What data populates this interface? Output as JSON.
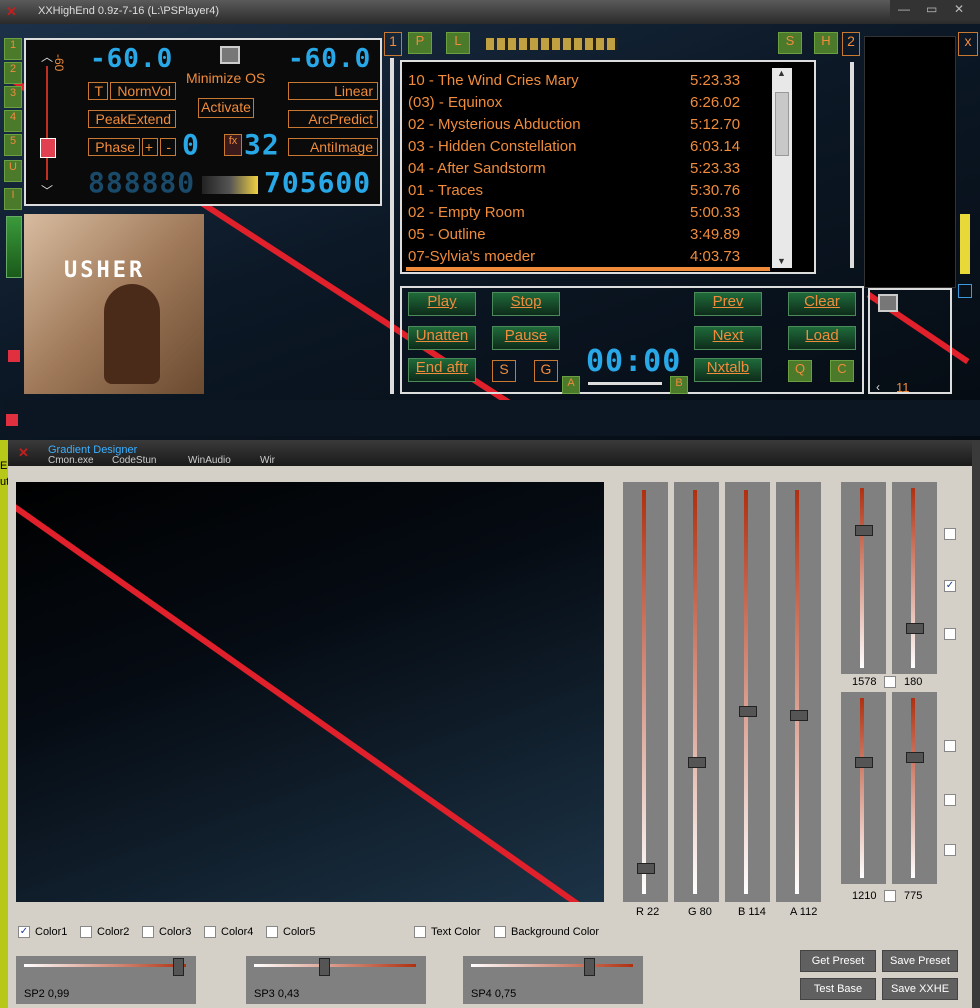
{
  "main_window": {
    "title": "XXHighEnd 0.9z-7-16 (L:\\PSPlayer4)",
    "left_tabs": [
      "1",
      "2",
      "3",
      "4",
      "5",
      "U",
      "I"
    ],
    "volume_readout_left": "-60.0",
    "volume_readout_right": "-60.0",
    "vol_scale_label": "-60",
    "minimize_os": "Minimize OS",
    "activate": "Activate",
    "buttons": {
      "t": "T",
      "normvol": "NormVol",
      "peakextend": "PeakExtend",
      "phase": "Phase",
      "plus": "+",
      "minus": "-",
      "linear": "Linear",
      "arcpredict": "ArcPredict",
      "antiimage": "AntiImage"
    },
    "fx_label": "fx",
    "fx_left": "0",
    "fx_right": "32",
    "counter_left": "888880",
    "counter_right": "705600",
    "panel_1": "1",
    "panel_2": "2",
    "close_x": "x",
    "p_btn": "P",
    "l_btn": "L",
    "s_btn": "S",
    "h_btn": "H",
    "album_text": "USHER"
  },
  "playlist": [
    {
      "title": "10 - The Wind Cries Mary",
      "duration": "5:23.33"
    },
    {
      "title": "(03) - Equinox",
      "duration": "6:26.02"
    },
    {
      "title": "02 - Mysterious Abduction",
      "duration": "5:12.70"
    },
    {
      "title": "03 - Hidden Constellation",
      "duration": "6:03.14"
    },
    {
      "title": "04 - After Sandstorm",
      "duration": "5:23.33"
    },
    {
      "title": "01 - Traces",
      "duration": "5:30.76"
    },
    {
      "title": "02 - Empty Room",
      "duration": "5:00.33"
    },
    {
      "title": "05 - Outline",
      "duration": "3:49.89"
    },
    {
      "title": "07-Sylvia's moeder",
      "duration": "4:03.73"
    }
  ],
  "transport": {
    "play": "Play",
    "stop": "Stop",
    "prev": "Prev",
    "clear": "Clear",
    "unatten": "Unatten",
    "pause": "Pause",
    "next": "Next",
    "load": "Load",
    "end_aftr": "End aftr",
    "s": "S",
    "g": "G",
    "nxtalb": "Nxtalb",
    "q": "Q",
    "c": "C",
    "a": "A",
    "b": "B",
    "time": "00:00"
  },
  "mini": {
    "value": "11"
  },
  "gradient_designer": {
    "title": "Gradient Designer",
    "behind_text": [
      "EX",
      "ut",
      "Cmon.exe",
      "CodeStun",
      "WinAudio",
      "Wir"
    ],
    "channels": [
      {
        "label": "R 22",
        "level": 0.05
      },
      {
        "label": "G 80",
        "level": 0.32
      },
      {
        "label": "B 114",
        "level": 0.45
      },
      {
        "label": "A 112",
        "level": 0.44
      }
    ],
    "pair1": {
      "left": "1578",
      "right": "180",
      "left_level": 0.78,
      "right_level": 0.2
    },
    "pair2": {
      "left": "1210",
      "right": "775",
      "left_level": 0.65,
      "right_level": 0.68
    },
    "side_checks": [
      false,
      true,
      false,
      false,
      false,
      false
    ],
    "color_checks": [
      {
        "label": "Color1",
        "checked": true
      },
      {
        "label": "Color2",
        "checked": false
      },
      {
        "label": "Color3",
        "checked": false
      },
      {
        "label": "Color4",
        "checked": false
      },
      {
        "label": "Color5",
        "checked": false
      }
    ],
    "text_color": "Text Color",
    "background_color": "Background Color",
    "sp_sliders": [
      {
        "label": "SP2 0,99",
        "value": 0.99
      },
      {
        "label": "SP3 0,43",
        "value": 0.43
      },
      {
        "label": "SP4 0,75",
        "value": 0.75
      }
    ],
    "get_preset": "Get Preset",
    "save_preset": "Save Preset",
    "test_base": "Test Base",
    "save_xxhe": "Save XXHE"
  }
}
